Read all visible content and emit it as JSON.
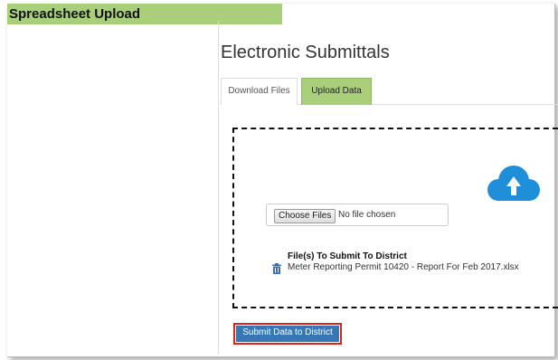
{
  "header": {
    "title": "Spreadsheet Upload"
  },
  "main": {
    "title": "Electronic Submittals",
    "tabs": [
      {
        "label": "Download Files",
        "active": false
      },
      {
        "label": "Upload Data",
        "active": true
      }
    ]
  },
  "upload": {
    "choose_button_label": "Choose Files",
    "no_file_text": "No file chosen",
    "files_heading": "File(s) To Submit To District",
    "files": [
      "Meter Reporting Permit 10420 - Report For Feb 2017.xlsx"
    ],
    "icons": {
      "cloud": "cloud-upload-icon",
      "delete": "trash-icon"
    }
  },
  "actions": {
    "submit_label": "Submit Data to District"
  },
  "colors": {
    "accent_green": "#a9cf7a",
    "primary_blue": "#3778b4",
    "cloud_blue": "#1e8fd8",
    "highlight_red": "#d9241c"
  }
}
